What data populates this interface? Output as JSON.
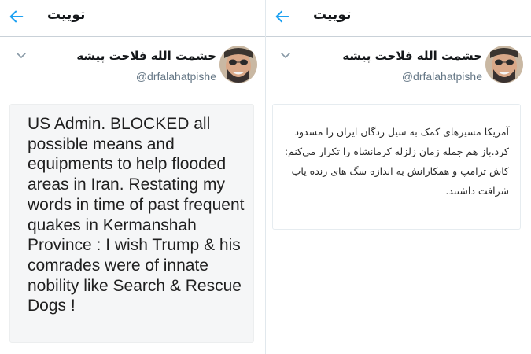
{
  "left": {
    "header_title": "توییت",
    "author_name": "حشمت الله فلاحت پیشه",
    "author_handle": "@drfalahatpishe",
    "tweet_text": "US Admin. BLOCKED all possible means and equipments to help flooded areas in Iran.  Restating my words in time of past frequent quakes in Kermanshah Province : I wish Trump & his comrades were of innate nobility like Search & Rescue Dogs !"
  },
  "right": {
    "header_title": "توییت",
    "author_name": "حشمت الله فلاحت پیشه",
    "author_handle": "@drfalahatpishe",
    "tweet_text": "آمریکا مسیرهای کمک به سیل زدگان ایران را مسدود کرد.باز هم جمله زمان زلزله کرمانشاه را تکرار می‌کنم: کاش ترامپ و همکارانش به اندازه سگ های زنده یاب شرافت داشتند."
  },
  "icons": {
    "back": "back-arrow-icon",
    "menu": "chevron-down-icon",
    "avatar": "avatar"
  },
  "colors": {
    "accent": "#1da1f2",
    "handle": "#657786",
    "tweet_bg_left": "#f5f6f7"
  }
}
